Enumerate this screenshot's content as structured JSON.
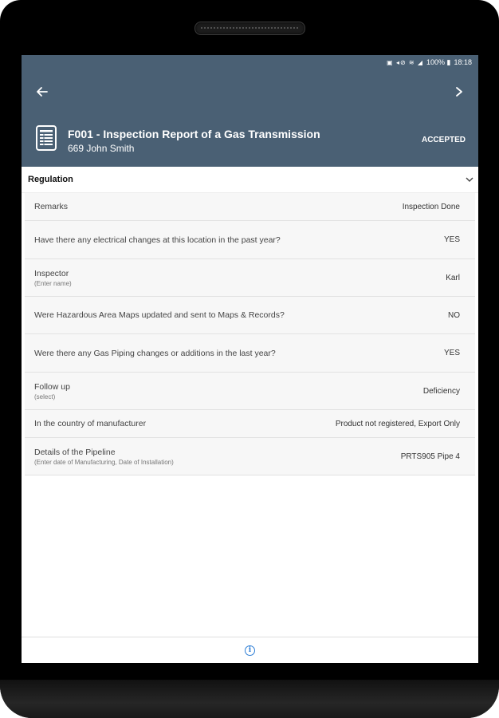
{
  "statusbar": {
    "icons": "▣ ◂⊘ ≋ ◢",
    "battery": "100% ▮",
    "time": "18:18"
  },
  "header": {
    "title": "F001 - Inspection Report of a Gas Transmission",
    "subtitle": "669 John Smith",
    "status": "ACCEPTED",
    "icons": {
      "back": "arrow-left-icon",
      "next": "chevron-right-icon",
      "doc": "document-icon"
    }
  },
  "section": {
    "title": "Regulation",
    "toggle_icon": "chevron-down-icon"
  },
  "rows": [
    {
      "label": "Remarks",
      "hint": "",
      "value": "Inspection Done"
    },
    {
      "label": "Have there any electrical changes at this location in the past year?",
      "hint": "",
      "value": "YES"
    },
    {
      "label": "Inspector",
      "hint": "(Enter name)",
      "value": "Karl"
    },
    {
      "label": "Were Hazardous Area Maps updated and sent to Maps & Records?",
      "hint": "",
      "value": "NO"
    },
    {
      "label": "Were there any Gas Piping changes or additions in the last year?",
      "hint": "",
      "value": "YES"
    },
    {
      "label": "Follow up",
      "hint": "(select)",
      "value": "Deficiency"
    },
    {
      "label": "In the country of manufacturer",
      "hint": "",
      "value": "Product not registered, Export Only"
    },
    {
      "label": "Details of the Pipeline",
      "hint": "(Enter date of Manufacturing, Date of Installation)",
      "value": "PRTS905 Pipe 4"
    }
  ],
  "footer": {
    "info_icon": "info-icon"
  }
}
